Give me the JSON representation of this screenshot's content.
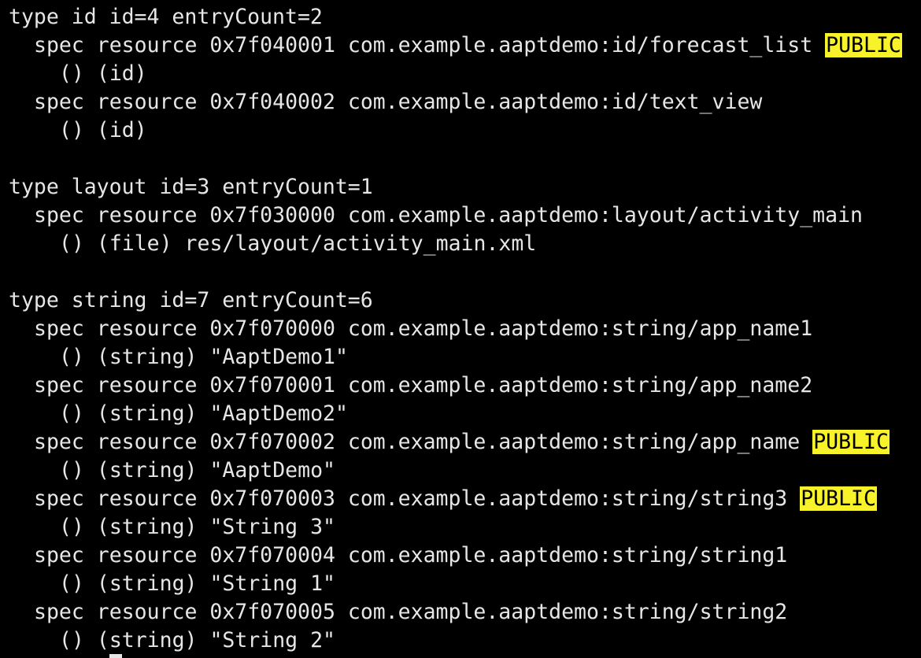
{
  "colors": {
    "background": "#000000",
    "text": "#e6e6e6",
    "highlight_bg": "#f7f22a",
    "highlight_text": "#000000"
  },
  "terminal": {
    "highlight_label": "PUBLIC",
    "blocks": [
      {
        "header": "type id id=4 entryCount=2",
        "entries": [
          {
            "spec": "spec resource 0x7f040001 com.example.aaptdemo:id/forecast_list",
            "public": true,
            "value": "() (id)"
          },
          {
            "spec": "spec resource 0x7f040002 com.example.aaptdemo:id/text_view",
            "public": false,
            "value": "() (id)"
          }
        ]
      },
      {
        "header": "type layout id=3 entryCount=1",
        "entries": [
          {
            "spec": "spec resource 0x7f030000 com.example.aaptdemo:layout/activity_main",
            "public": false,
            "value": "() (file) res/layout/activity_main.xml"
          }
        ]
      },
      {
        "header": "type string id=7 entryCount=6",
        "entries": [
          {
            "spec": "spec resource 0x7f070000 com.example.aaptdemo:string/app_name1",
            "public": false,
            "value": "() (string) \"AaptDemo1\""
          },
          {
            "spec": "spec resource 0x7f070001 com.example.aaptdemo:string/app_name2",
            "public": false,
            "value": "() (string) \"AaptDemo2\""
          },
          {
            "spec": "spec resource 0x7f070002 com.example.aaptdemo:string/app_name",
            "public": true,
            "value": "() (string) \"AaptDemo\""
          },
          {
            "spec": "spec resource 0x7f070003 com.example.aaptdemo:string/string3",
            "public": true,
            "value": "() (string) \"String 3\""
          },
          {
            "spec": "spec resource 0x7f070004 com.example.aaptdemo:string/string1",
            "public": false,
            "value": "() (string) \"String 1\""
          },
          {
            "spec": "spec resource 0x7f070005 com.example.aaptdemo:string/string2",
            "public": false,
            "value": "() (string) \"String 2\""
          }
        ]
      }
    ]
  }
}
